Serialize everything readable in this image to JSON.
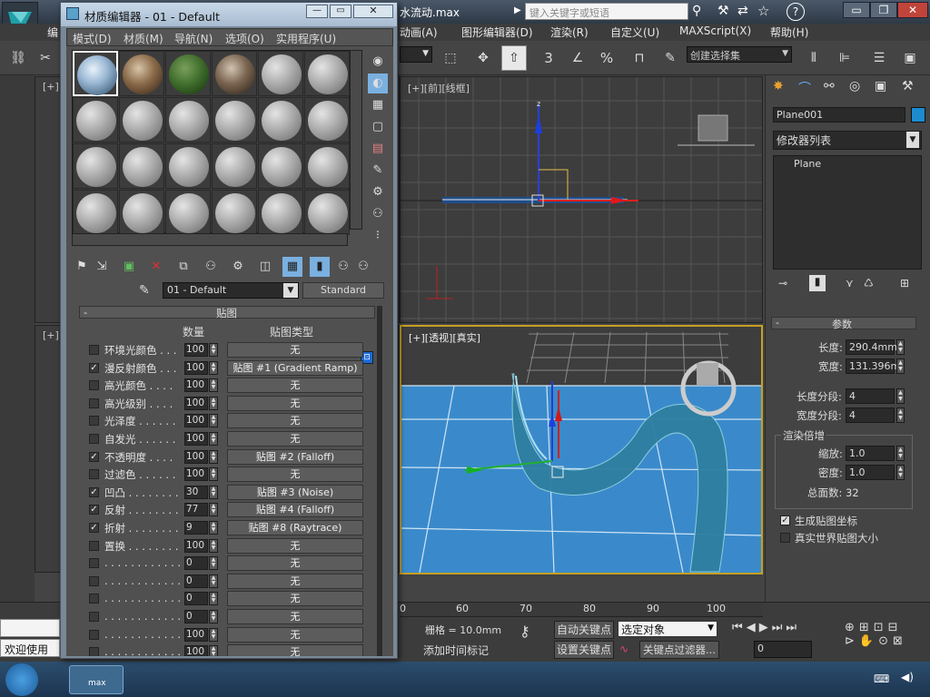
{
  "app": {
    "title_fragment": "水流动.max",
    "search_placeholder": "键入关键字或短语",
    "menus": [
      "编",
      "动画(A)",
      "图形编辑器(D)",
      "渲染(R)",
      "自定义(U)",
      "MAXScript(X)",
      "帮助(H)"
    ],
    "selection_set": "创建选择集",
    "toolbar_numbers": [
      "3",
      "%"
    ]
  },
  "viewports": {
    "top_left_label": "[+]",
    "front_label": "[+][前][线框]",
    "bottom_left_label": "[+]",
    "persp_label": "[+][透视][真实]",
    "ruler_ticks": [
      "0",
      "60",
      "70",
      "80",
      "90",
      "100"
    ]
  },
  "command_panel": {
    "object_name": "Plane001",
    "modifier_list": "修改器列表",
    "stack_item": "Plane",
    "params_header": "参数",
    "length_label": "长度:",
    "length_value": "290.4mm",
    "width_label": "宽度:",
    "width_value": "131.396m",
    "length_segs_label": "长度分段:",
    "length_segs": "4",
    "width_segs_label": "宽度分段:",
    "width_segs": "4",
    "render_mult_label": "渲染倍增",
    "scale_label": "缩放:",
    "scale_value": "1.0",
    "density_label": "密度:",
    "density_value": "1.0",
    "total_faces": "总面数: 32",
    "gen_map_coords": "生成贴图坐标",
    "real_world_map": "真实世界贴图大小"
  },
  "bottom": {
    "welcome": "欢迎使用",
    "grid": "栅格 = 10.0mm",
    "auto_key": "自动关键点",
    "selected_object": "选定对象",
    "add_time_tag": "添加时间标记",
    "set_key": "设置关键点",
    "key_filter": "关键点过滤器...",
    "frame": "0"
  },
  "material_editor": {
    "title": "材质编辑器 - 01 - Default",
    "menus": [
      "模式(D)",
      "材质(M)",
      "导航(N)",
      "选项(O)",
      "实用程序(U)"
    ],
    "material_name": "01 - Default",
    "material_type": "Standard",
    "maps_header": "贴图",
    "col_amount": "数量",
    "col_maptype": "贴图类型",
    "rows": [
      {
        "label": "环境光颜色 . . .",
        "checked": false,
        "amount": "100",
        "map": "无"
      },
      {
        "label": "漫反射颜色 . . .",
        "checked": true,
        "amount": "100",
        "map": "贴图 #1 (Gradient Ramp)"
      },
      {
        "label": "高光颜色 . . . .",
        "checked": false,
        "amount": "100",
        "map": "无"
      },
      {
        "label": "高光级别 . . . .",
        "checked": false,
        "amount": "100",
        "map": "无"
      },
      {
        "label": "光泽度 . . . . . .",
        "checked": false,
        "amount": "100",
        "map": "无"
      },
      {
        "label": "自发光 . . . . . .",
        "checked": false,
        "amount": "100",
        "map": "无"
      },
      {
        "label": "不透明度 . . . .",
        "checked": true,
        "amount": "100",
        "map": "贴图 #2 (Falloff)"
      },
      {
        "label": "过滤色 . . . . . .",
        "checked": false,
        "amount": "100",
        "map": "无"
      },
      {
        "label": "凹凸 . . . . . . . .",
        "checked": true,
        "amount": "30",
        "map": "贴图 #3 (Noise)"
      },
      {
        "label": "反射 . . . . . . . .",
        "checked": true,
        "amount": "77",
        "map": "贴图 #4 (Falloff)"
      },
      {
        "label": "折射 . . . . . . . .",
        "checked": true,
        "amount": "9",
        "map": "贴图 #8 (Raytrace)"
      },
      {
        "label": "置换 . . . . . . . .",
        "checked": false,
        "amount": "100",
        "map": "无"
      },
      {
        "label": ". . . . . . . . . . . .",
        "checked": false,
        "amount": "0",
        "map": "无"
      },
      {
        "label": ". . . . . . . . . . . .",
        "checked": false,
        "amount": "0",
        "map": "无"
      },
      {
        "label": ". . . . . . . . . . . .",
        "checked": false,
        "amount": "0",
        "map": "无"
      },
      {
        "label": ". . . . . . . . . . . .",
        "checked": false,
        "amount": "0",
        "map": "无"
      },
      {
        "label": ". . . . . . . . . . . .",
        "checked": false,
        "amount": "100",
        "map": "无"
      },
      {
        "label": ". . . . . . . . . . . .",
        "checked": false,
        "amount": "100",
        "map": "无"
      }
    ]
  },
  "taskbar": {
    "app_label": "max"
  },
  "colors": {
    "viewport_bg": "#3d3d3d",
    "persp_water": "#3a8acb",
    "accent_blue": "#4a90d9"
  }
}
